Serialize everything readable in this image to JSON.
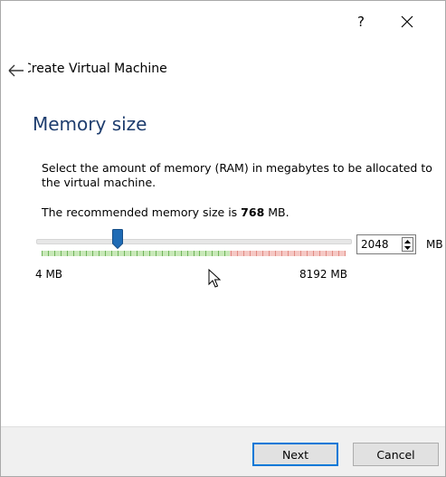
{
  "window": {
    "help_label": "?",
    "close_icon": "close-icon"
  },
  "header": {
    "title": "Create Virtual Machine",
    "back_icon": "back-arrow-icon"
  },
  "page": {
    "title": "Memory size",
    "description": "Select the amount of memory (RAM) in megabytes to be allocated to the virtual machine.",
    "recommend_prefix": "The recommended memory size is ",
    "recommend_value": "768",
    "recommend_suffix": " MB."
  },
  "memory": {
    "min_label": "4 MB",
    "max_label": "8192 MB",
    "min_mb": 4,
    "max_mb": 8192,
    "current_mb": 2048,
    "value": "2048",
    "unit": "MB",
    "recommended_max_fraction": 0.62
  },
  "colors": {
    "accent": "#0078d7",
    "title": "#1e3d6e",
    "thumb": "#1f6bb5",
    "safe_zone": "#c8e8b8",
    "danger_zone": "#f5c8c4"
  },
  "footer": {
    "next_label": "Next",
    "cancel_label": "Cancel"
  }
}
